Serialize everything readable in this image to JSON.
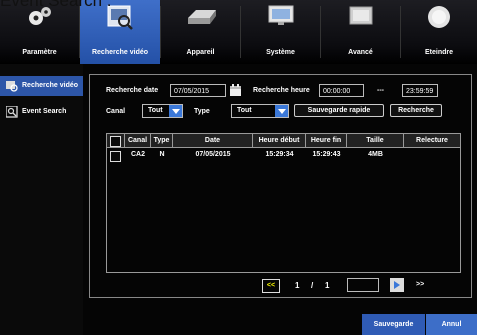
{
  "caption": "Event Search :",
  "tabs": [
    {
      "label": "Paramètre",
      "icon": "gears-icon"
    },
    {
      "label": "Recherche vidéo",
      "icon": "video-search-icon",
      "active": true
    },
    {
      "label": "Appareil",
      "icon": "hard-drive-icon"
    },
    {
      "label": "Système",
      "icon": "monitor-icon"
    },
    {
      "label": "Avancé",
      "icon": "advanced-icon"
    },
    {
      "label": "Eteindre",
      "icon": "power-icon"
    }
  ],
  "sidebar": {
    "items": [
      {
        "label": "Recherche vidéo",
        "icon": "video-search-icon",
        "active": true
      },
      {
        "label": "Event Search",
        "icon": "event-search-icon",
        "active": false
      }
    ]
  },
  "search": {
    "date_label": "Recherche date",
    "date_value": "07/05/2015",
    "time_label": "Recherche heure",
    "time_start": "00:00:00",
    "time_sep": "---",
    "time_end": "23:59:59",
    "canal_label": "Canal",
    "canal_value": "Tout",
    "type_label": "Type",
    "type_value": "Tout",
    "quick_save_label": "Sauvegarde rapide",
    "search_label": "Recherche"
  },
  "table": {
    "columns": [
      "Canal",
      "Type",
      "Date",
      "Heure début",
      "Heure fin",
      "Taille",
      "Relecture"
    ],
    "rows": [
      {
        "canal": "CA2",
        "type": "N",
        "date": "07/05/2015",
        "start": "15:29:34",
        "end": "15:29:43",
        "size": "4MB"
      }
    ]
  },
  "pager": {
    "prev_label": "<<",
    "current": "1",
    "sep": "/",
    "total": "1",
    "next_label": ">>"
  },
  "footer": {
    "save_label": "Sauvegarde",
    "cancel_label": "Annul"
  },
  "colors": {
    "accent": "#2d56a8",
    "dropdown": "#3b78d8",
    "background": "#050505"
  }
}
